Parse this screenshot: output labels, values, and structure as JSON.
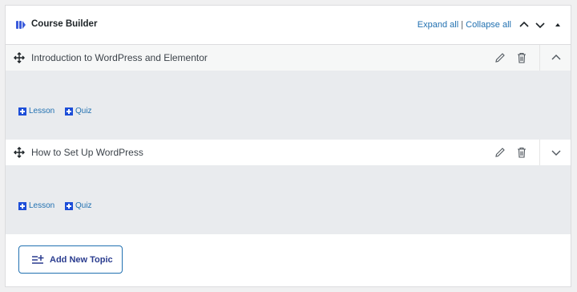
{
  "header": {
    "title": "Course Builder",
    "expand_all": "Expand all",
    "separator": " | ",
    "collapse_all": "Collapse all"
  },
  "topics": [
    {
      "title": "Introduction to WordPress and Elementor",
      "expanded": true
    },
    {
      "title": "How to Set Up WordPress",
      "expanded": false
    }
  ],
  "item_actions": {
    "lesson": "Lesson",
    "quiz": "Quiz"
  },
  "add_topic": {
    "label": "Add New Topic"
  },
  "colors": {
    "accent": "#2271b1",
    "plus_bg": "#1d4ed8",
    "body_bg": "#e9ebee"
  },
  "icons": {
    "header": "course-builder-icon",
    "drag": "drag-move-icon",
    "edit": "pencil-icon",
    "delete": "trash-icon",
    "chevron_up": "chevron-up-icon",
    "chevron_down": "chevron-down-icon",
    "collapse": "caret-up-icon",
    "add_topic": "list-plus-icon"
  }
}
